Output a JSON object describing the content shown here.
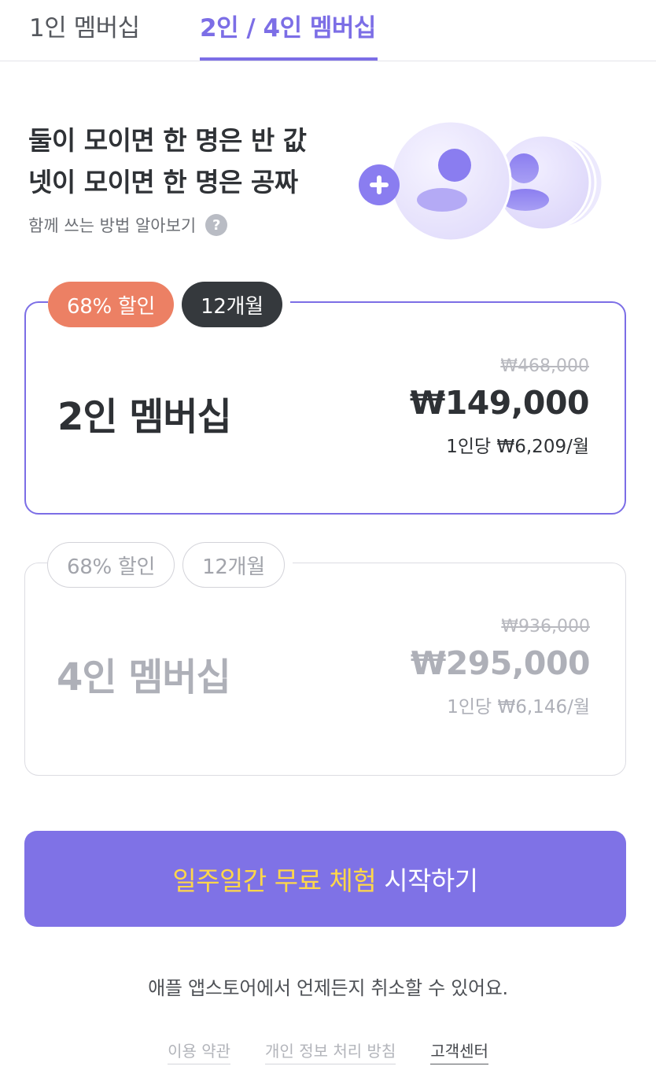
{
  "tabs": [
    {
      "label": "1인 멤버십",
      "active": false
    },
    {
      "label": "2인 / 4인 멤버십",
      "active": true
    }
  ],
  "hero": {
    "line1": "둘이 모이면 한 명은 반 값",
    "line2": "넷이 모이면 한 명은 공짜",
    "how_to": "함께 쓰는 방법 알아보기",
    "help_icon": "?"
  },
  "plans": [
    {
      "discount_badge": "68% 할인",
      "period_badge": "12개월",
      "name": "2인 멤버십",
      "original_price": "₩468,000",
      "price": "₩149,000",
      "per_person": "1인당 ₩6,209/월",
      "selected": true
    },
    {
      "discount_badge": "68% 할인",
      "period_badge": "12개월",
      "name": "4인 멤버십",
      "original_price": "₩936,000",
      "price": "₩295,000",
      "per_person": "1인당 ₩6,146/월",
      "selected": false
    }
  ],
  "cta": {
    "highlight": "일주일간 무료 체험",
    "rest": "시작하기"
  },
  "cancel_note": "애플 앱스토어에서 언제든지 취소할 수 있어요.",
  "footer": {
    "terms": "이용 약관",
    "privacy": "개인 정보 처리 방침",
    "support": "고객센터"
  },
  "colors": {
    "accent": "#7c6ee6",
    "cta_background": "#7f72e6",
    "cta_highlight": "#ffd749",
    "discount_badge": "#ec8064",
    "period_badge": "#35393d"
  }
}
